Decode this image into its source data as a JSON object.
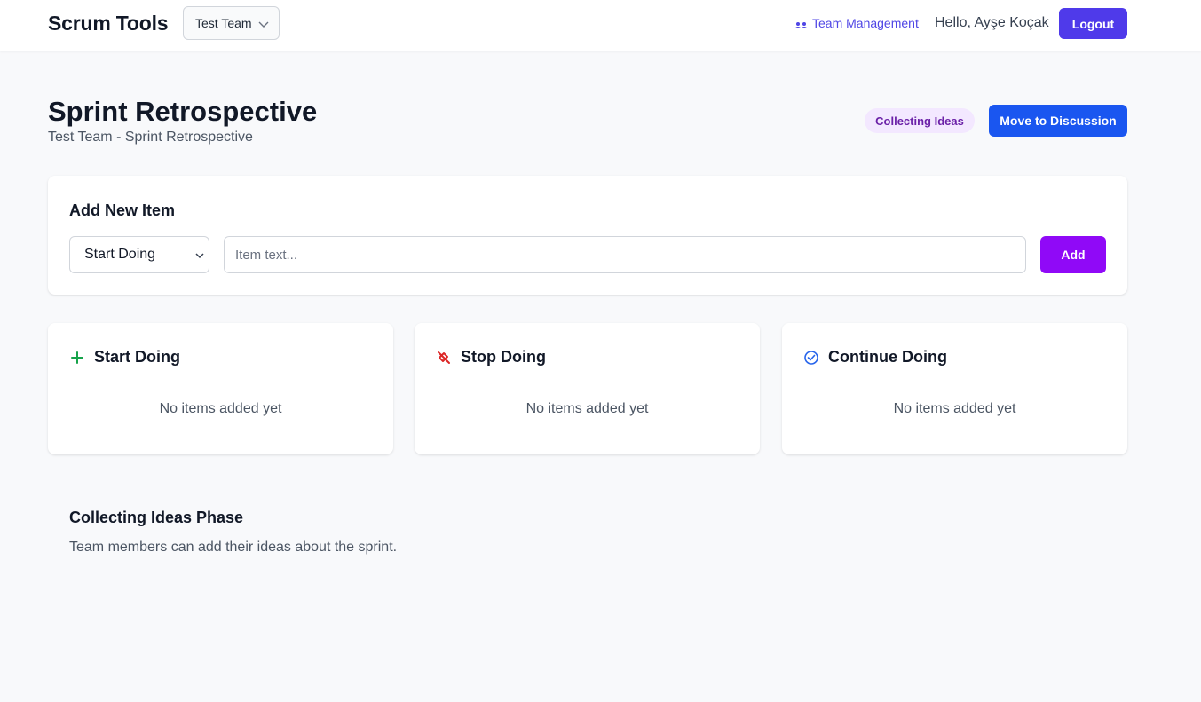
{
  "app": {
    "brand": "Scrum Tools",
    "team_selected": "Test Team",
    "team_management_label": "Team Management",
    "greeting": "Hello, Ayşe Koçak",
    "logout_label": "Logout"
  },
  "header": {
    "title": "Sprint Retrospective",
    "subtitle": "Test Team - Sprint Retrospective",
    "phase_badge": "Collecting Ideas",
    "move_button_label": "Move to Discussion"
  },
  "add_item": {
    "title": "Add New Item",
    "category_selected": "Start Doing",
    "input_placeholder": "Item text...",
    "input_value": "",
    "add_button_label": "Add"
  },
  "columns": [
    {
      "title": "Start Doing",
      "icon": "plus-icon",
      "empty_text": "No items added yet",
      "color": "#16a34a"
    },
    {
      "title": "Stop Doing",
      "icon": "stop-icon",
      "empty_text": "No items added yet",
      "color": "#dc2626"
    },
    {
      "title": "Continue Doing",
      "icon": "check-circle-icon",
      "empty_text": "No items added yet",
      "color": "#2563eb"
    }
  ],
  "phase_info": {
    "title": "Collecting Ideas Phase",
    "description": "Team members can add their ideas about the sprint."
  },
  "colors": {
    "logout_bg": "#4f3aea",
    "move_bg": "#1a56f0",
    "add_bg": "#9009f7",
    "badge_bg": "#f3e8ff",
    "badge_text": "#6b21a8",
    "link": "#4f46e5"
  }
}
